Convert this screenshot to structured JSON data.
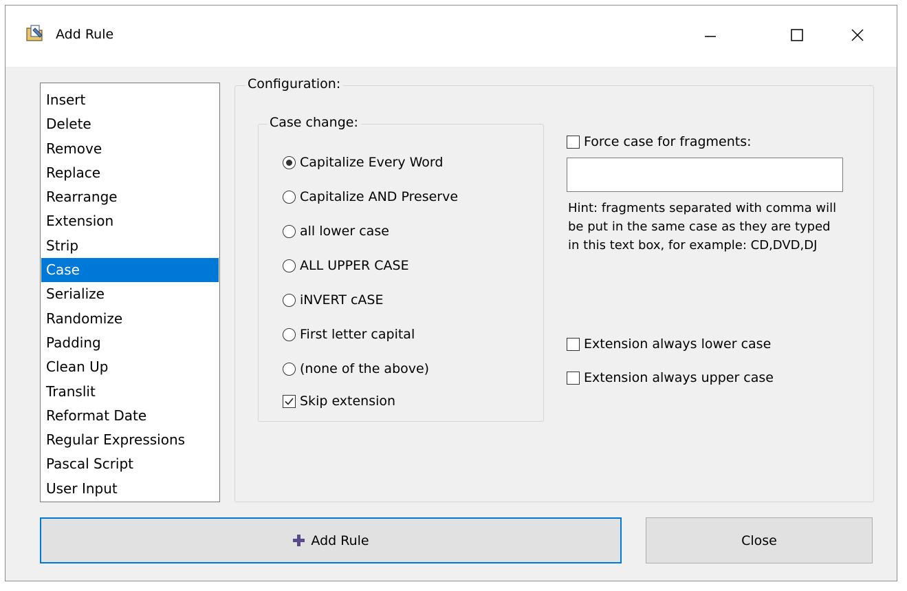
{
  "window": {
    "title": "Add Rule",
    "app_icon": "folder-rename-icon",
    "controls": [
      "minimize-icon",
      "maximize-icon",
      "close-icon"
    ]
  },
  "rules": {
    "items": [
      "Insert",
      "Delete",
      "Remove",
      "Replace",
      "Rearrange",
      "Extension",
      "Strip",
      "Case",
      "Serialize",
      "Randomize",
      "Padding",
      "Clean Up",
      "Translit",
      "Reformat Date",
      "Regular Expressions",
      "Pascal Script",
      "User Input"
    ],
    "selected": "Case"
  },
  "config": {
    "legend": "Configuration:",
    "case_change": {
      "legend": "Case change:",
      "options": [
        {
          "label": "Capitalize Every Word",
          "checked": true
        },
        {
          "label": "Capitalize AND Preserve",
          "checked": false
        },
        {
          "label": "all lower case",
          "checked": false
        },
        {
          "label": "ALL UPPER CASE",
          "checked": false
        },
        {
          "label": "iNVERT cASE",
          "checked": false
        },
        {
          "label": "First letter capital",
          "checked": false
        },
        {
          "label": "(none of the above)",
          "checked": false
        }
      ],
      "skip_extension": {
        "label": "Skip extension",
        "checked": true
      }
    },
    "force_fragments": {
      "label": "Force case for fragments:",
      "checked": false,
      "value": ""
    },
    "hint": "Hint: fragments separated with comma will be put in the same case as they are typed in this text box, for example: CD,DVD,DJ",
    "ext_lower": {
      "label": "Extension always lower case",
      "checked": false
    },
    "ext_upper": {
      "label": "Extension always upper case",
      "checked": false
    }
  },
  "buttons": {
    "add_rule": "Add Rule",
    "add_icon": "plus-icon",
    "close": "Close"
  },
  "colors": {
    "selection": "#0078d7",
    "plus_icon": "#5a4a8a",
    "window_bg": "#f0f0f0"
  }
}
